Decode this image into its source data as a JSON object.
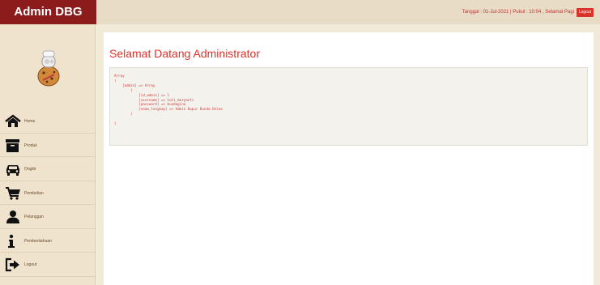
{
  "app": {
    "brand": "Admin DBG"
  },
  "header": {
    "info": "Tanggal : 01-Jul-2021 | Pukul : 10:04 , Selamat Pagi",
    "logout_label": "Logout"
  },
  "sidebar": {
    "items": [
      {
        "label": "Home",
        "icon": "home-icon"
      },
      {
        "label": "Produk",
        "icon": "box-icon"
      },
      {
        "label": "Ongkir",
        "icon": "car-icon"
      },
      {
        "label": "Pembelian",
        "icon": "cart-icon"
      },
      {
        "label": "Pelanggan",
        "icon": "user-icon"
      },
      {
        "label": "Pemberitahuan",
        "icon": "info-icon"
      },
      {
        "label": "Logout",
        "icon": "sign-out-icon"
      }
    ]
  },
  "main": {
    "title": "Selamat Datang Administrator",
    "code_lines": [
      "Array",
      "(",
      "    [admin] => Array",
      "        (",
      "            [id_admin] => 1",
      "            [username] => tuti_maryanti",
      "            [password] => bundagina",
      "            [nama_lengkap] => Admin Dapur Bunda Ghina",
      "        )",
      "",
      ")"
    ]
  },
  "colors": {
    "brand": "#8c1b1c",
    "accent": "#e0322b",
    "sidebar_bg": "#efe3cd"
  }
}
